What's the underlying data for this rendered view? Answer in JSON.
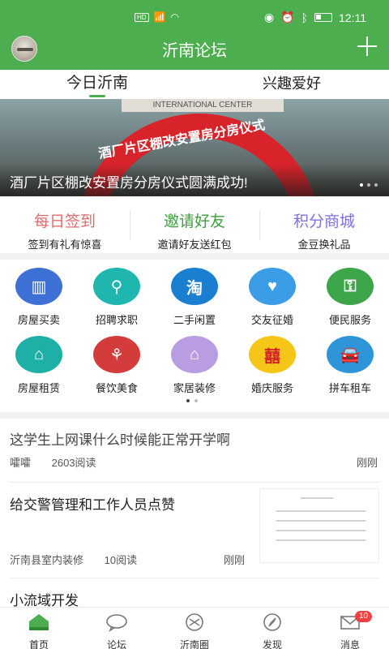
{
  "status": {
    "network_label": "HD",
    "time": "12:11"
  },
  "header": {
    "title": "沂南论坛"
  },
  "tabs": [
    {
      "label": "今日沂南"
    },
    {
      "label": "兴趣爱好"
    }
  ],
  "banner": {
    "caption": "酒厂片区棚改安置房分房仪式圆满成功!",
    "arch_text": "酒厂片区棚改安置房分房仪式",
    "sign_text": "INTERNATIONAL CENTER"
  },
  "shortcuts": [
    {
      "title": "每日签到",
      "subtitle": "签到有礼有惊喜",
      "color": "#e06b6f"
    },
    {
      "title": "邀请好友",
      "subtitle": "邀请好友送红包",
      "color": "#3f9e3f"
    },
    {
      "title": "积分商城",
      "subtitle": "金豆换礼品",
      "color": "#7b74d8"
    }
  ],
  "categories": [
    {
      "label": "房屋买卖",
      "icon": "building-icon",
      "glyph": "▥",
      "color": "#3e70d6"
    },
    {
      "label": "招聘求职",
      "icon": "person-search-icon",
      "glyph": "⚲",
      "color": "#1fb6b0"
    },
    {
      "label": "二手闲置",
      "icon": "taobao-icon",
      "glyph": "淘",
      "color": "#1a7fd0"
    },
    {
      "label": "交友征婚",
      "icon": "couple-icon",
      "glyph": "♥",
      "color": "#3a9de6"
    },
    {
      "label": "便民服务",
      "icon": "key-icon",
      "glyph": "⚿",
      "color": "#3da64a"
    },
    {
      "label": "房屋租赁",
      "icon": "house-icon",
      "glyph": "⌂",
      "color": "#1eb0a6"
    },
    {
      "label": "餐饮美食",
      "icon": "cutlery-icon",
      "glyph": "⚘",
      "color": "#d43c3c"
    },
    {
      "label": "家居装修",
      "icon": "home-decor-icon",
      "glyph": "⌂",
      "color": "#b99de2"
    },
    {
      "label": "婚庆服务",
      "icon": "double-happiness-icon",
      "glyph": "囍",
      "color": "#f5c518"
    },
    {
      "label": "拼车租车",
      "icon": "car-icon",
      "glyph": "🚘",
      "color": "#2f95d9"
    }
  ],
  "posts": [
    {
      "title": "这学生上网课什么时候能正常开学啊",
      "author": "嚯嚯",
      "reads": "2603阅读",
      "time": "刚刚"
    },
    {
      "title": "给交警管理和工作人员点赞",
      "author": "沂南县室内装修",
      "reads": "10阅读",
      "time": "刚刚"
    },
    {
      "title": "小流域开发"
    }
  ],
  "bottom_nav": [
    {
      "label": "首页",
      "icon": "home-icon",
      "active": true
    },
    {
      "label": "论坛",
      "icon": "chat-bubble-icon"
    },
    {
      "label": "沂南圈",
      "icon": "circle-lens-icon"
    },
    {
      "label": "发现",
      "icon": "compass-icon"
    },
    {
      "label": "消息",
      "icon": "mail-icon",
      "badge": "10"
    }
  ],
  "colors": {
    "brand": "#4cae4f",
    "badge": "#f04141"
  }
}
